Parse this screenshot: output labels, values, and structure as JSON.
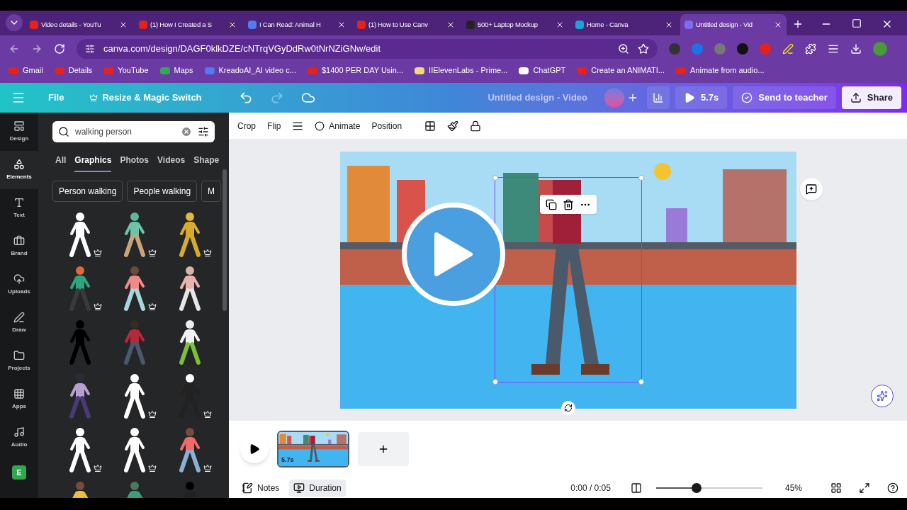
{
  "browser": {
    "tabs": [
      {
        "title": "Video details - YouTu",
        "selected": false
      },
      {
        "title": "(1) How I Created a S",
        "selected": false
      },
      {
        "title": "I Can Read: Animal H",
        "selected": false
      },
      {
        "title": "(1) How to Use Canv",
        "selected": false
      },
      {
        "title": "500+ Laptop Mockup",
        "selected": false
      },
      {
        "title": "Home - Canva",
        "selected": false
      },
      {
        "title": "Untitled design - Vid",
        "selected": true
      }
    ],
    "url": "canva.com/design/DAGF0klkDZE/cNTrqVGyDdRw0tNrNZiGNw/edit",
    "bookmarks": [
      "Gmail",
      "Details",
      "YouTube",
      "Maps",
      "KreadoAI_AI video c...",
      "$1400 PER DAY Usin...",
      "IIElevenLabs - Prime...",
      "ChatGPT",
      "Create an ANIMATI...",
      "Animate from audio..."
    ]
  },
  "header": {
    "file": "File",
    "resize": "Resize & Magic Switch",
    "title": "Untitled design - Video",
    "play_time": "5.7s",
    "send": "Send to teacher",
    "share": "Share"
  },
  "rail": [
    {
      "label": "Design",
      "selected": false
    },
    {
      "label": "Elements",
      "selected": true
    },
    {
      "label": "Text",
      "selected": false
    },
    {
      "label": "Brand",
      "selected": false
    },
    {
      "label": "Uploads",
      "selected": false
    },
    {
      "label": "Draw",
      "selected": false
    },
    {
      "label": "Projects",
      "selected": false
    },
    {
      "label": "Apps",
      "selected": false
    },
    {
      "label": "Audio",
      "selected": false
    }
  ],
  "rail_app": "E",
  "search": {
    "value": "walking person"
  },
  "panel_tabs": [
    {
      "label": "All",
      "selected": false
    },
    {
      "label": "Graphics",
      "selected": true
    },
    {
      "label": "Photos",
      "selected": false
    },
    {
      "label": "Videos",
      "selected": false
    },
    {
      "label": "Shape",
      "selected": false
    }
  ],
  "chips": [
    "Person walking",
    "People walking",
    "M"
  ],
  "toolbar": [
    "Crop",
    "Flip",
    "Animate",
    "Position"
  ],
  "timeline": {
    "clip_duration": "5.7s"
  },
  "footer": {
    "notes": "Notes",
    "duration": "Duration",
    "time": "0:00 / 0:05",
    "zoom": {
      "level": 0.38
    },
    "zoom_label": "45%"
  }
}
